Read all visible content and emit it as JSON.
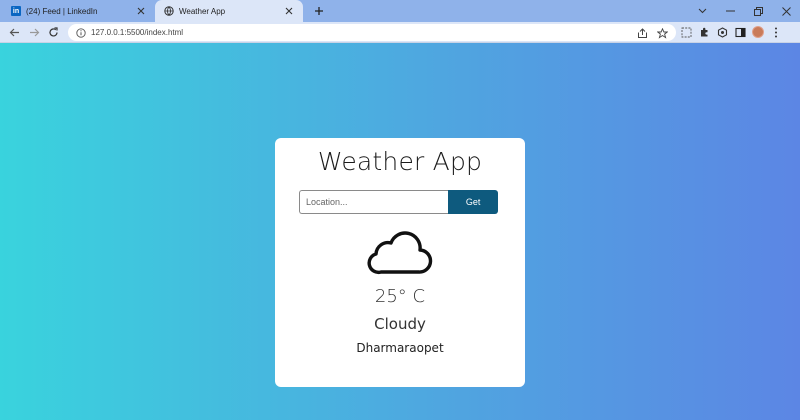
{
  "browser": {
    "tabs": [
      {
        "title": "(24) Feed | LinkedIn",
        "favicon": "linkedin-icon",
        "active": false
      },
      {
        "title": "Weather App",
        "favicon": "globe-icon",
        "active": true
      }
    ],
    "address_bar": {
      "url": "127.0.0.1:5500/index.html"
    },
    "colors": {
      "tabstrip": "#8fb2ea",
      "toolbar": "#dce6f8"
    }
  },
  "app": {
    "title": "Weather App",
    "search": {
      "placeholder": "Location...",
      "value": "",
      "button_label": "Get"
    },
    "weather": {
      "icon": "cloud-icon",
      "temperature": "25° C",
      "condition": "Cloudy",
      "location": "Dharmaraopet"
    },
    "colors": {
      "gradient_start": "#39d3dd",
      "gradient_end": "#5c86e4",
      "button": "#0e5a7e",
      "card": "#ffffff"
    }
  }
}
